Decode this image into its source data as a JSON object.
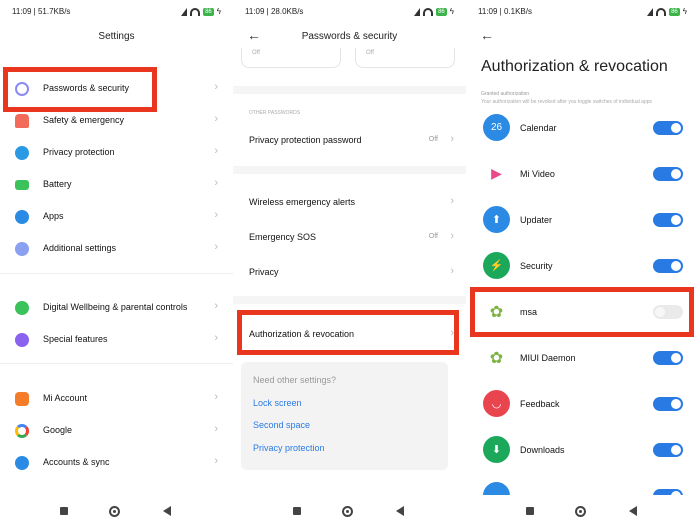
{
  "panel1": {
    "status": {
      "time": "11:09",
      "speed": "51.7KB/s",
      "battery": "86"
    },
    "title": "Settings",
    "items": [
      {
        "label": "Passwords & security",
        "icon": "fingerprint-icon",
        "color": "#8a8af5"
      },
      {
        "label": "Safety & emergency",
        "icon": "siren-icon",
        "color": "#f26b5b"
      },
      {
        "label": "Privacy protection",
        "icon": "privacy-icon",
        "color": "#2a9ae4"
      },
      {
        "label": "Battery",
        "icon": "battery-icon",
        "color": "#3cc25a"
      },
      {
        "label": "Apps",
        "icon": "gear-icon",
        "color": "#2a8ae4"
      },
      {
        "label": "Additional settings",
        "icon": "dots-icon",
        "color": "#8aa0f0"
      },
      {
        "label": "Digital Wellbeing & parental controls",
        "icon": "wellbeing-icon",
        "color": "#3cc25a"
      },
      {
        "label": "Special features",
        "icon": "special-features-icon",
        "color": "#8a62f0"
      },
      {
        "label": "Mi Account",
        "icon": "mi-icon",
        "color": "#f57c28"
      },
      {
        "label": "Google",
        "icon": "google-icon",
        "color": "#4285f4"
      },
      {
        "label": "Accounts & sync",
        "icon": "account-icon",
        "color": "#2a8ae4"
      }
    ]
  },
  "panel2": {
    "status": {
      "time": "11:09",
      "speed": "28.0KB/s",
      "battery": "86"
    },
    "title": "Passwords & security",
    "top_values": [
      "Off",
      "Off"
    ],
    "section_header": "OTHER PASSWORDS",
    "rows": [
      {
        "label": "Privacy protection password",
        "value": "Off"
      },
      {
        "label": "Wireless emergency alerts",
        "value": ""
      },
      {
        "label": "Emergency SOS",
        "value": "Off"
      },
      {
        "label": "Privacy",
        "value": ""
      },
      {
        "label": "Authorization & revocation",
        "value": ""
      }
    ],
    "card": {
      "question": "Need other settings?",
      "links": [
        "Lock screen",
        "Second space",
        "Privacy protection"
      ]
    }
  },
  "panel3": {
    "status": {
      "time": "11:09",
      "speed": "0.1KB/s",
      "battery": "86"
    },
    "title": "Authorization & revocation",
    "subtitle": "Granted authorization",
    "note": "Your authorization will be revoked after you toggle switches of individual apps",
    "apps": [
      {
        "label": "Calendar",
        "icon": "calendar-icon",
        "glyph": "26",
        "color": "#2a8ae4",
        "enabled": true
      },
      {
        "label": "Mi Video",
        "icon": "mi-video-icon",
        "glyph": "▶",
        "color": "#ffffff",
        "enabled": true
      },
      {
        "label": "Updater",
        "icon": "updater-icon",
        "glyph": "⬆",
        "color": "#2a8ae4",
        "enabled": true
      },
      {
        "label": "Security",
        "icon": "security-icon",
        "glyph": "⚡",
        "color": "#1ba85a",
        "enabled": true
      },
      {
        "label": "msa",
        "icon": "android-icon",
        "glyph": "✿",
        "color": "#7cb342",
        "enabled": false
      },
      {
        "label": "MIUI Daemon",
        "icon": "android-icon",
        "glyph": "✿",
        "color": "#7cb342",
        "enabled": true
      },
      {
        "label": "Feedback",
        "icon": "feedback-icon",
        "glyph": "◡",
        "color": "#e8454f",
        "enabled": true
      },
      {
        "label": "Downloads",
        "icon": "downloads-icon",
        "glyph": "⬇",
        "color": "#1ba85a",
        "enabled": true
      }
    ]
  },
  "colors": {
    "accent": "#2a7ae4",
    "highlight": "#e8361f"
  }
}
